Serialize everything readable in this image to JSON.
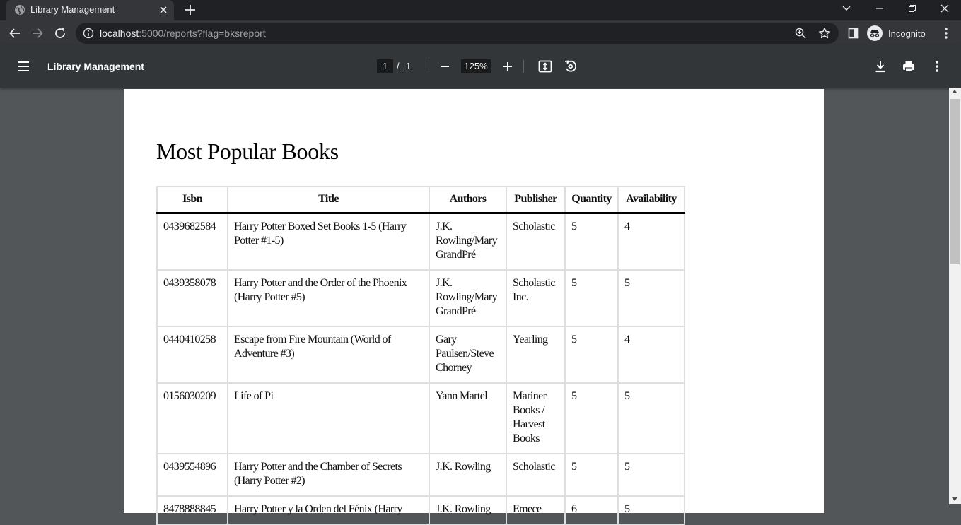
{
  "browser": {
    "tab_title": "Library Management",
    "url_host": "localhost",
    "url_rest": ":5000/reports?flag=bksreport",
    "profile_label": "Incognito"
  },
  "pdf": {
    "title": "Library Management",
    "current_page": "1",
    "page_separator": "/",
    "total_pages": "1",
    "zoom": "125%"
  },
  "report": {
    "heading": "Most Popular Books",
    "columns": [
      "Isbn",
      "Title",
      "Authors",
      "Publisher",
      "Quantity",
      "Availability"
    ],
    "rows": [
      [
        "0439682584",
        "Harry Potter Boxed Set Books 1-5 (Harry Potter #1-5)",
        "J.K. Rowling/Mary GrandPré",
        "Scholastic",
        "5",
        "4"
      ],
      [
        "0439358078",
        "Harry Potter and the Order of the Phoenix (Harry Potter #5)",
        "J.K. Rowling/Mary GrandPré",
        "Scholastic Inc.",
        "5",
        "5"
      ],
      [
        "0440410258",
        "Escape from Fire Mountain (World of Adventure #3)",
        "Gary Paulsen/Steve Chorney",
        "Yearling",
        "5",
        "4"
      ],
      [
        "0156030209",
        "Life of Pi",
        "Yann Martel",
        "Mariner Books / Harvest Books",
        "5",
        "5"
      ],
      [
        "0439554896",
        "Harry Potter and the Chamber of Secrets (Harry Potter #2)",
        "J.K. Rowling",
        "Scholastic",
        "5",
        "5"
      ],
      [
        "8478888845",
        "Harry Potter y la Orden del Fénix (Harry",
        "J.K. Rowling",
        "Emece",
        "6",
        "5"
      ]
    ]
  }
}
